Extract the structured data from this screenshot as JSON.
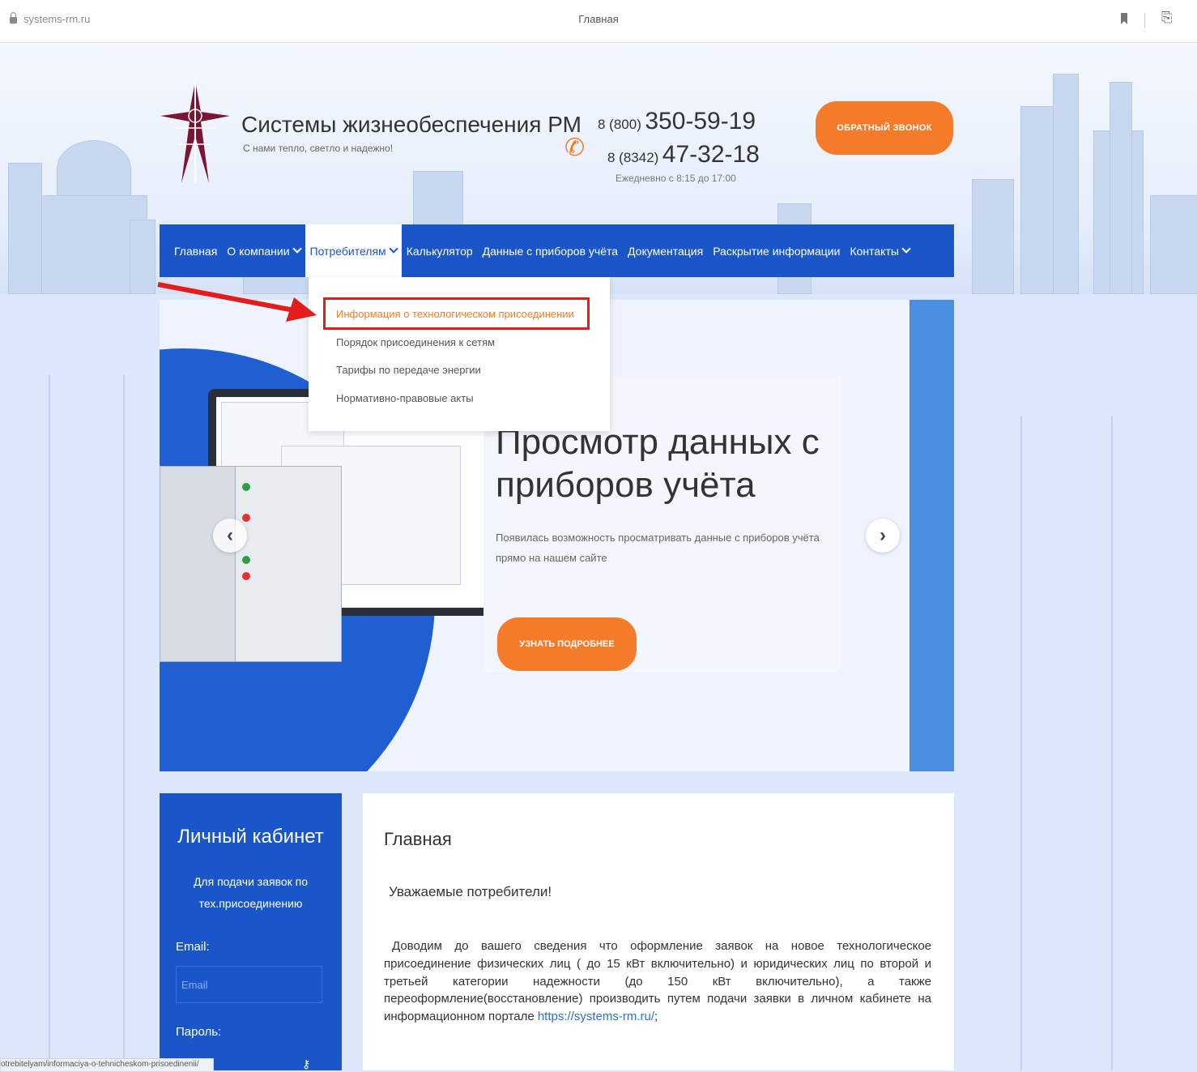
{
  "browser": {
    "url": "systems-rm.ru",
    "tab_title": "Главная"
  },
  "header": {
    "title": "Системы жизнеобеспечения РМ",
    "subtitle": "С нами тепло, светло и надежно!",
    "phone1_code": "8 (800)",
    "phone1_number": "350-59-19",
    "phone2_code": "8 (8342)",
    "phone2_number": "47-32-18",
    "hours": "Ежедневно с 8:15 до 17:00",
    "callback_label": "ОБРАТНЫЙ ЗВОНОК"
  },
  "nav": {
    "items": [
      {
        "label": "Главная"
      },
      {
        "label": "О компании"
      },
      {
        "label": "Потребителям"
      },
      {
        "label": "Калькулятор"
      },
      {
        "label": "Данные с приборов учёта"
      },
      {
        "label": "Документация"
      },
      {
        "label": "Раскрытие информации"
      },
      {
        "label": "Контакты"
      }
    ],
    "dropdown": [
      {
        "label": "Информация о технологическом присоединении"
      },
      {
        "label": "Порядок присоединения к сетям"
      },
      {
        "label": "Тарифы по передаче энергии"
      },
      {
        "label": "Нормативно-правовые акты"
      }
    ]
  },
  "slider": {
    "title_line1": "Просмотр данных с",
    "title_line2": "приборов учёта",
    "text": "Появилась возможность просматривать данные с приборов учёта прямо на нашем сайте",
    "button_label": "УЗНАТЬ ПОДРОБНЕЕ"
  },
  "cabinet": {
    "title": "Личный кабинет",
    "subtitle": "Для подачи заявок по тех.присоединению",
    "email_label": "Email:",
    "email_placeholder": "Email",
    "password_label": "Пароль:"
  },
  "content": {
    "title": "Главная",
    "greeting": "Уважаемые потребители!",
    "body": "Доводим до вашего сведения что оформление заявок на новое технологическое присоединение физических лиц ( до 15 кВт включительно) и юридических лиц по второй и третьей категории надежности (до 150 кВт включительно), а также переоформление(восстановление) производить путем подачи заявки в личном кабинете на информационном портале",
    "link": "https://systems-rm.ru/",
    "body_end": ";"
  },
  "status_bar": {
    "url": "otrebitelyam/informaciya-o-tehnicheskom-prisoedinenii/"
  },
  "colors": {
    "brand_blue": "#1b56c9",
    "accent_orange": "#f47b2a",
    "annotation_red": "#e41c1c",
    "logo_maroon": "#7a1633"
  }
}
